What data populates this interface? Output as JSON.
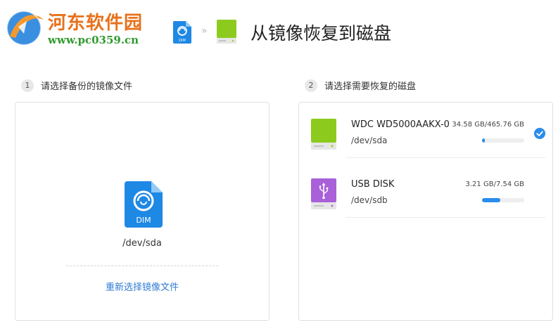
{
  "watermark": {
    "title": "河东软件园",
    "url": "www.pc0359.cn"
  },
  "header": {
    "title": "从镜像恢复到磁盘",
    "file_icon_label": "DIM",
    "chevron": "»"
  },
  "step1": {
    "number": "1",
    "label": "请选择备份的镜像文件"
  },
  "step2": {
    "number": "2",
    "label": "请选择需要恢复的磁盘"
  },
  "image_file": {
    "icon_label": "DIM",
    "path": "/dev/sda",
    "reselect_label": "重新选择镜像文件"
  },
  "disks": [
    {
      "name": "WDC WD5000AAKX-0",
      "path": "/dev/sda",
      "size": "34.58 GB/465.76 GB",
      "usage": 0.074,
      "icon": "green-hard-disk-icon",
      "selected": true
    },
    {
      "name": "USB DISK",
      "path": "/dev/sdb",
      "size": "3.21 GB/7.54 GB",
      "usage": 0.426,
      "icon": "purple-usb-disk-icon",
      "selected": false
    }
  ],
  "colors": {
    "accent": "#2a8cec",
    "link": "#2e7bd4",
    "disk_green": "#8ccb1e",
    "usb_purple": "#a960d8",
    "watermark_orange": "#e7711b",
    "watermark_green": "#2f9a2f"
  }
}
